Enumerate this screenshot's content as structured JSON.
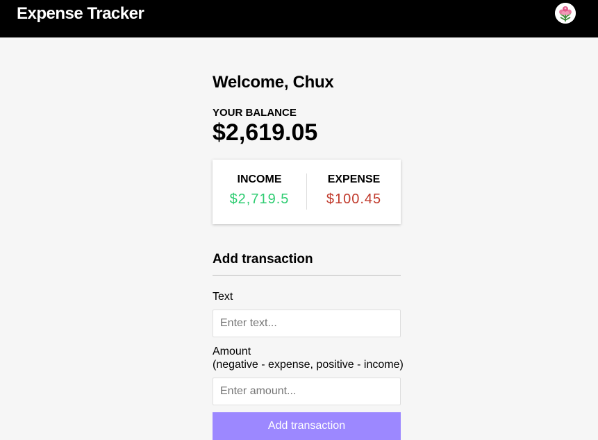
{
  "header": {
    "title": "Expense Tracker",
    "avatar_icon": "flower-avatar-icon"
  },
  "main": {
    "welcome": "Welcome, Chux",
    "balance_label": "YOUR BALANCE",
    "balance_amount": "$2,619.05",
    "income_label": "INCOME",
    "income_amount": "$2,719.5",
    "expense_label": "EXPENSE",
    "expense_amount": "$100.45"
  },
  "form": {
    "title": "Add transaction",
    "text_label": "Text",
    "text_placeholder": "Enter text...",
    "text_value": "",
    "amount_label": "Amount",
    "amount_hint": "(negative - expense, positive - income)",
    "amount_placeholder": "Enter amount...",
    "amount_value": "",
    "submit_label": "Add transaction"
  },
  "colors": {
    "navbar": "#000000",
    "background": "#f6f6f6",
    "income": "#2ecc71",
    "expense": "#c0392b",
    "button": "#9c88ff"
  }
}
